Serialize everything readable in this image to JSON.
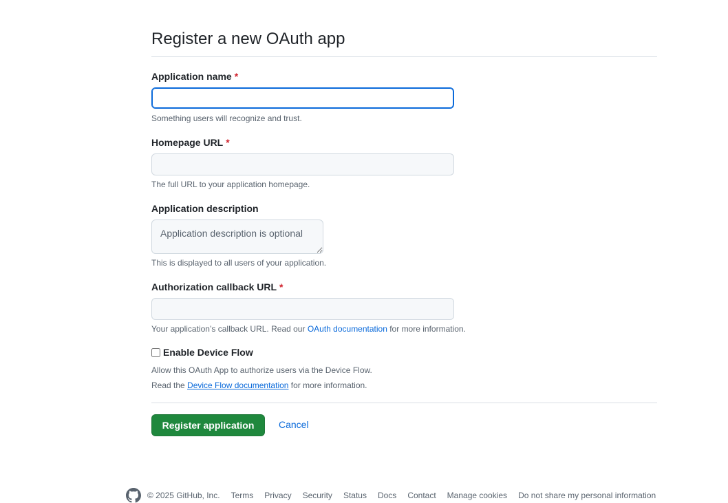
{
  "page_title": "Register a new OAuth app",
  "fields": {
    "app_name": {
      "label": "Application name",
      "required_marker": "*",
      "value": "",
      "note": "Something users will recognize and trust."
    },
    "homepage_url": {
      "label": "Homepage URL",
      "required_marker": "*",
      "value": "",
      "note": "The full URL to your application homepage."
    },
    "description": {
      "label": "Application description",
      "placeholder": "Application description is optional",
      "note": "This is displayed to all users of your application."
    },
    "callback_url": {
      "label": "Authorization callback URL",
      "required_marker": "*",
      "value": "",
      "note_prefix": "Your application’s callback URL. Read our ",
      "note_link": "OAuth documentation",
      "note_suffix": " for more information."
    }
  },
  "device_flow": {
    "label": "Enable Device Flow",
    "checked": false,
    "note_line1": "Allow this OAuth App to authorize users via the Device Flow.",
    "note_line2_prefix": "Read the ",
    "note_line2_link": "Device Flow documentation",
    "note_line2_suffix": " for more information."
  },
  "actions": {
    "register_label": "Register application",
    "cancel_label": "Cancel"
  },
  "footer": {
    "logo_icon": "github-logo-icon",
    "copyright": "© 2025 GitHub, Inc.",
    "links": [
      "Terms",
      "Privacy",
      "Security",
      "Status",
      "Docs",
      "Contact",
      "Manage cookies",
      "Do not share my personal information"
    ]
  },
  "colors": {
    "primary_button": "#1f883d",
    "link": "#0969da",
    "required": "#d1242f",
    "focus": "#0969da"
  }
}
